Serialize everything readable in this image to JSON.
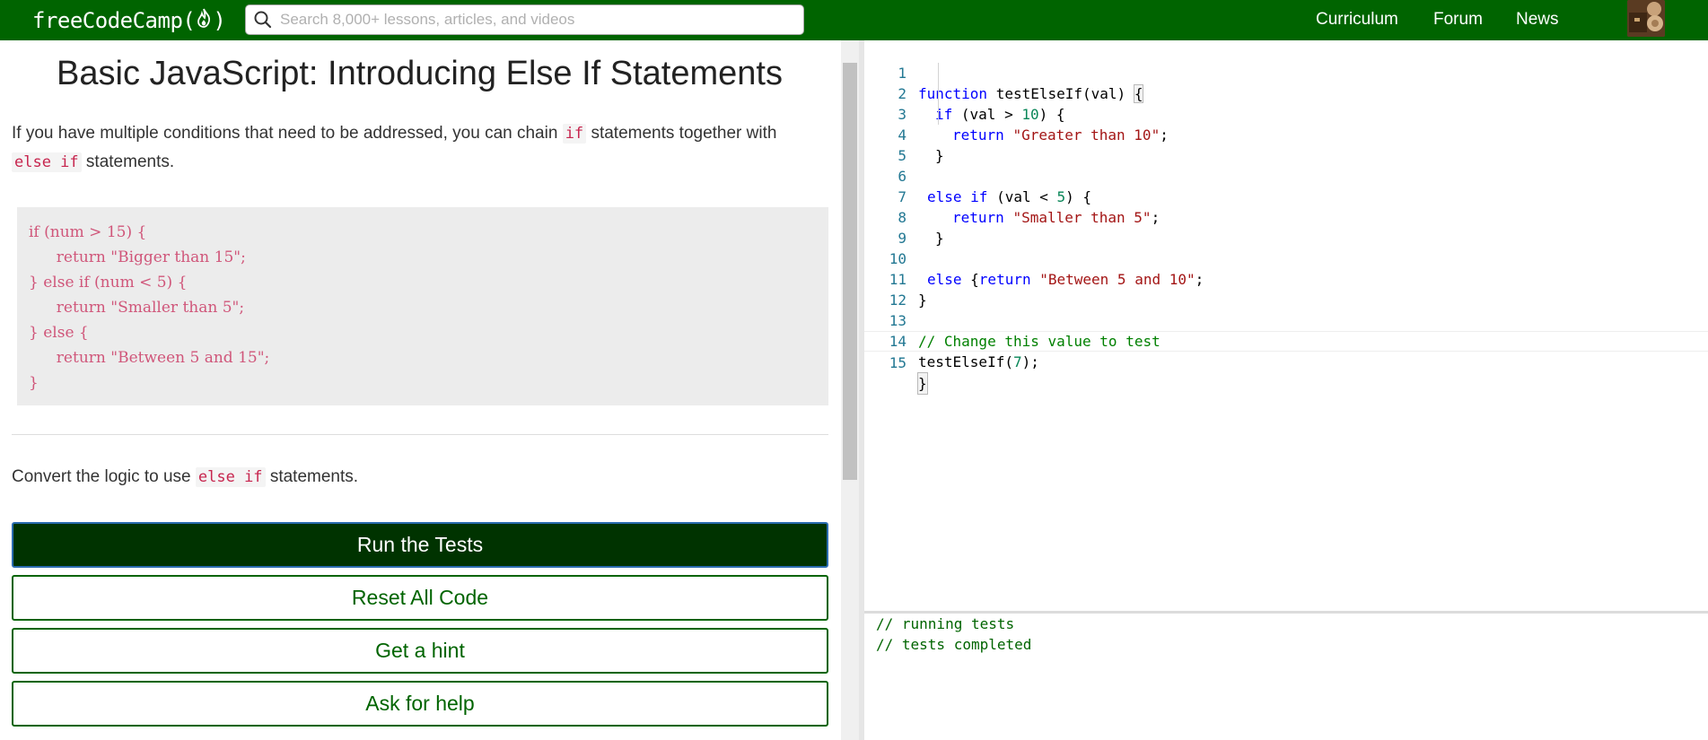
{
  "nav": {
    "logo_text_pre": "freeCodeCamp(",
    "logo_text_post": ")",
    "search_placeholder": "Search 8,000+ lessons, articles, and videos",
    "links": [
      "Curriculum",
      "Forum",
      "News"
    ],
    "bar_color": "#006400"
  },
  "lesson": {
    "title": "Basic JavaScript: Introducing Else If Statements",
    "intro_before": "If you have multiple conditions that need to be addressed, you can chain ",
    "intro_code1": "if",
    "intro_middle": " statements together with",
    "intro_code2": "else if",
    "intro_after": " statements.",
    "example_lines": [
      "if (num > 15) {",
      "  return \"Bigger than 15\";",
      "} else if (num < 5) {",
      "  return \"Smaller than 5\";",
      "} else {",
      "  return \"Between 5 and 15\";",
      "}"
    ],
    "task_before": "Convert the logic to use ",
    "task_code": "else if",
    "task_after": " statements."
  },
  "buttons": {
    "run": "Run the Tests",
    "reset": "Reset All Code",
    "hint": "Get a hint",
    "help": "Ask for help"
  },
  "editor": {
    "line_numbers": [
      "1",
      "2",
      "3",
      "4",
      "5",
      "6",
      "7",
      "8",
      "9",
      "10",
      "11",
      "12",
      "13",
      "14",
      "15"
    ],
    "l1_kw": "function",
    "l1_rest": " testElseIf(val) ",
    "l1_brace": "{",
    "l2_kw": "if",
    "l2_a": " (val > ",
    "l2_num": "10",
    "l2_b": ") {",
    "l3_kw": "return",
    "l3_str": "\"Greater than 10\"",
    "l3_end": ";",
    "l4": "}",
    "l6_kw1": "else",
    "l6_kw2": "if",
    "l6_a": " (val < ",
    "l6_num": "5",
    "l6_b": ") {",
    "l7_kw": "return",
    "l7_str": "\"Smaller than 5\"",
    "l7_end": ";",
    "l8": "}",
    "l10_kw1": "else",
    "l10_brace": " {",
    "l10_kw2": "return",
    "l10_str": "\"Between 5 and 10\"",
    "l10_end": ";",
    "l11": "}",
    "l13_cmt": "// Change this value to test",
    "l14_a": "testElseIf(",
    "l14_num": "7",
    "l14_b": ");",
    "l15": "}"
  },
  "console": {
    "lines": [
      "// running tests",
      "// tests completed"
    ]
  }
}
